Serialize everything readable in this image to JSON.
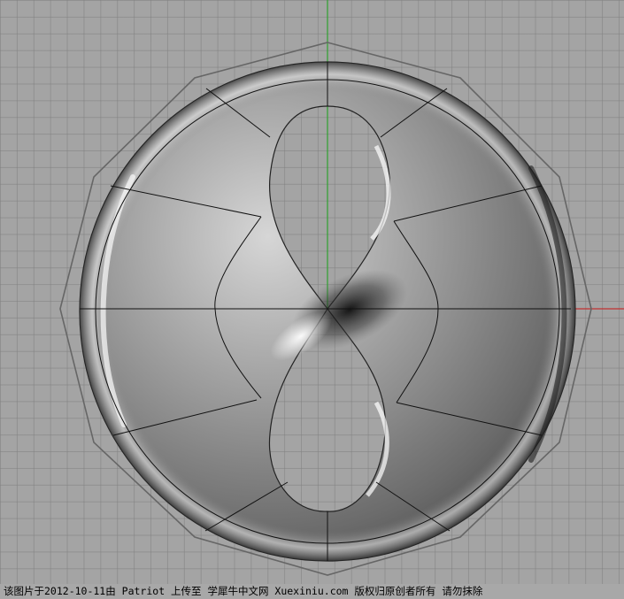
{
  "viewport": {
    "view": "Top",
    "grid": true,
    "axis_colors": {
      "x": "#c03030",
      "y": "#2fa02f"
    },
    "object": "torus-with-figure-eight-hole",
    "control_polygon_color": "#6c6c6c",
    "surface_shading": "gray-metallic"
  },
  "watermark": {
    "text": "该图片于2012-10-11由 Patriot 上传至 学犀牛中文网 Xuexiniu.com 版权归原创者所有 请勿抹除"
  }
}
